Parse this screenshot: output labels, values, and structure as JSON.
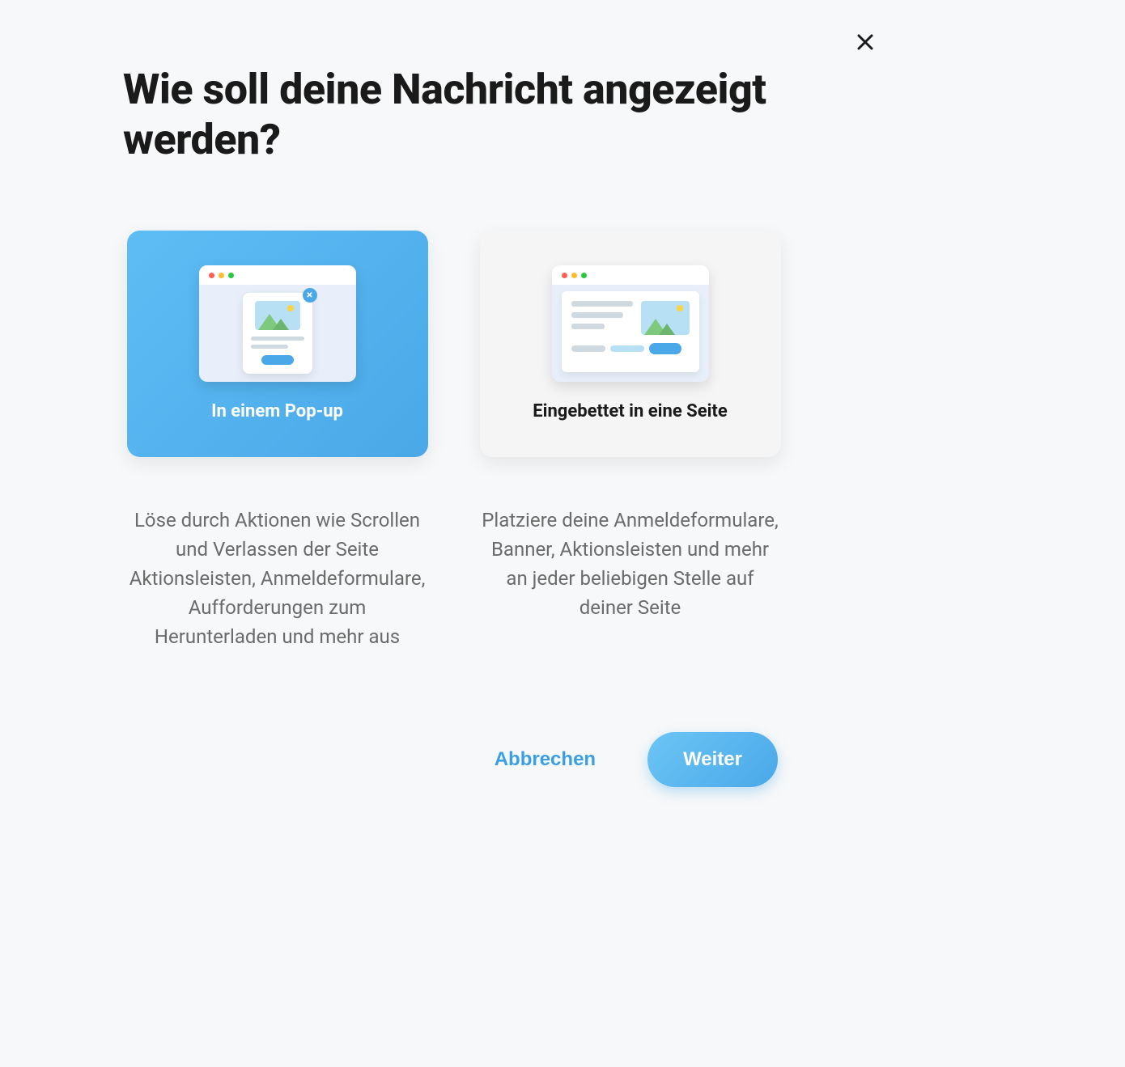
{
  "modal": {
    "title": "Wie soll deine Nachricht angezeigt werden?",
    "options": [
      {
        "label": "In einem Pop-up",
        "description": "Löse durch Aktionen wie Scrollen und Verlassen der Seite Aktionsleisten, Anmeldeformulare, Aufforderungen zum Herunterladen und mehr aus",
        "selected": true
      },
      {
        "label": "Eingebettet in eine Seite",
        "description": "Platziere deine Anmeldeformulare, Banner, Aktionsleisten und mehr an jeder beliebigen Stelle auf deiner Seite",
        "selected": false
      }
    ],
    "footer": {
      "cancel_label": "Abbrechen",
      "continue_label": "Weiter"
    }
  }
}
